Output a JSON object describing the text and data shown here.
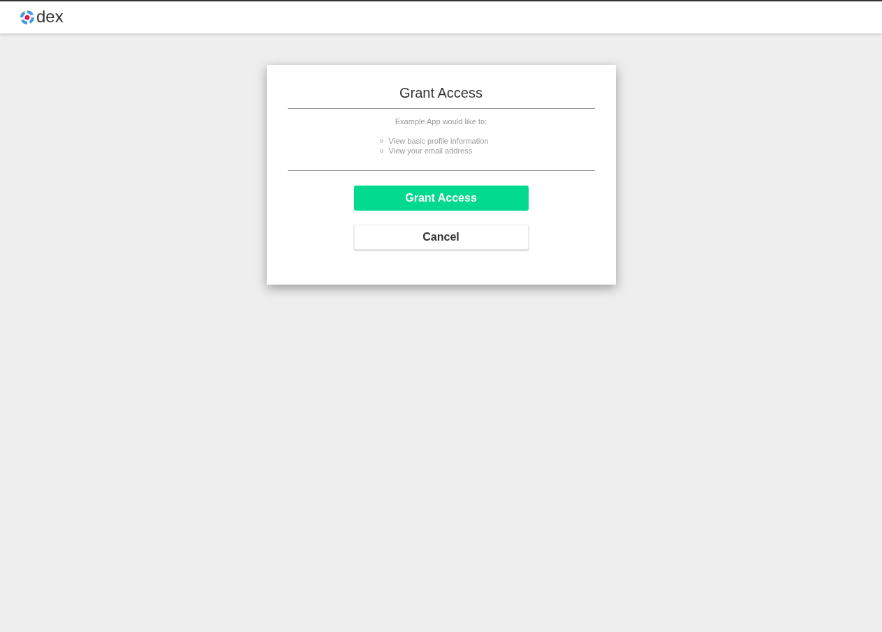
{
  "header": {
    "logo_text": "dex"
  },
  "card": {
    "title": "Grant Access",
    "intro": "Example App would like to:",
    "scopes": [
      "View basic profile information",
      "View your email address"
    ],
    "buttons": [
      {
        "kind": "primary",
        "label": "Grant Access"
      },
      {
        "kind": "secondary",
        "label": "Cancel"
      }
    ]
  }
}
